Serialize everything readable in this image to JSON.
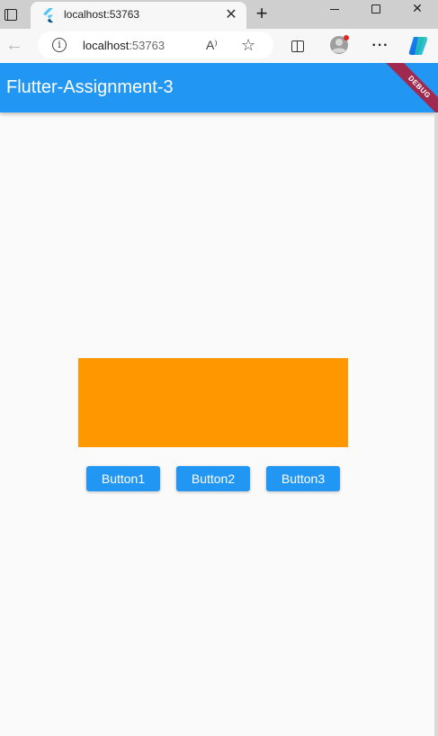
{
  "browser": {
    "tab": {
      "title": "localhost:53763",
      "favicon": "flutter-logo-icon",
      "close_glyph": "✕"
    },
    "new_tab_glyph": "+",
    "window_controls": {
      "close_glyph": "✕"
    },
    "toolbar": {
      "back_glyph": "←",
      "site_info_glyph": "i",
      "url_host": "localhost",
      "url_port": ":53763",
      "read_aloud_glyph": "A⁾",
      "favorite_glyph": "☆",
      "more_glyph": "···"
    }
  },
  "app": {
    "appbar_title": "Flutter-Assignment-3",
    "debug_banner": "DEBUG",
    "buttons": [
      {
        "label": "Button1"
      },
      {
        "label": "Button2"
      },
      {
        "label": "Button3"
      }
    ]
  },
  "colors": {
    "appbar": "#2196f3",
    "button": "#2196f3",
    "box": "#ff9800",
    "debug_ribbon": "#a02a4f",
    "background": "#fafafa"
  }
}
